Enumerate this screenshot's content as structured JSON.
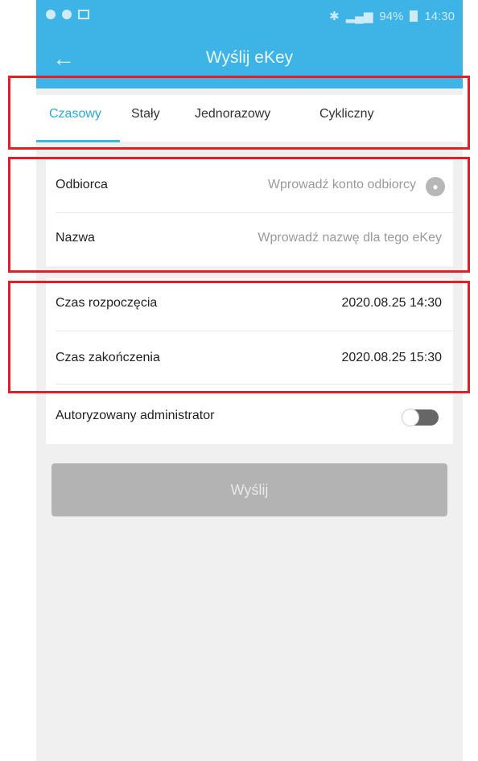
{
  "status_bar": {
    "battery": "94%",
    "time": "14:30"
  },
  "header": {
    "title": "Wyślij eKey",
    "back_icon": "←"
  },
  "tabs": [
    {
      "label": "Czasowy",
      "active": true
    },
    {
      "label": "Stały",
      "active": false
    },
    {
      "label": "Jednorazowy",
      "active": false
    },
    {
      "label": "Cykliczny",
      "active": false
    }
  ],
  "form": {
    "recipient": {
      "label": "Odbiorca",
      "placeholder": "Wprowadź konto odbiorcy",
      "icon": "contact-icon"
    },
    "name": {
      "label": "Nazwa",
      "placeholder": "Wprowadź nazwę dla tego eKey"
    },
    "start_time": {
      "label": "Czas rozpoczęcia",
      "value": "2020.08.25 14:30"
    },
    "end_time": {
      "label": "Czas zakończenia",
      "value": "2020.08.25 15:30"
    },
    "admin": {
      "label": "Autoryzowany administrator",
      "enabled": false
    }
  },
  "send_button": {
    "label": "Wyślij"
  },
  "colors": {
    "primary": "#3db3e6",
    "active_tab": "#2aa8d6",
    "highlight": "#e41e26",
    "button_disabled": "#b3b3b3"
  }
}
